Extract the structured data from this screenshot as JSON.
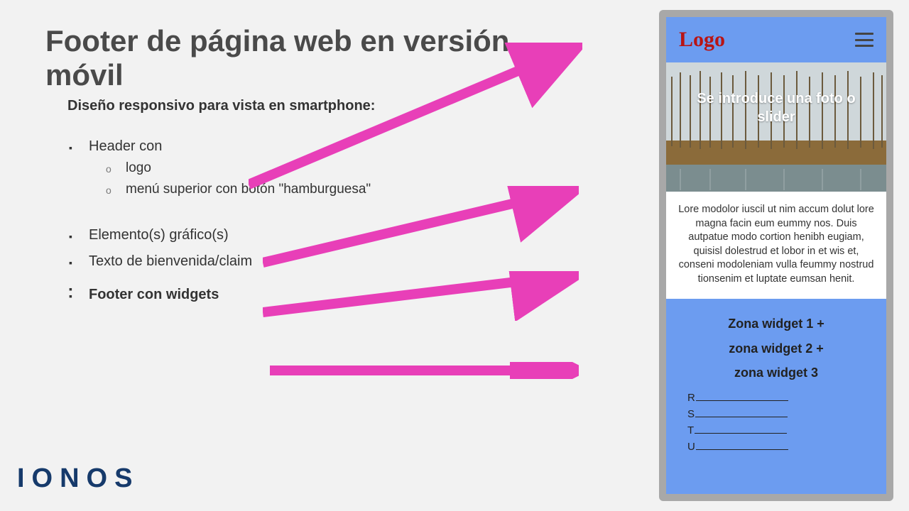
{
  "title": "Footer de página web en versión móvil",
  "subheading": "Diseño responsivo para vista en smartphone:",
  "bullets": {
    "b1": "Header con",
    "b1a": "logo",
    "b1b": "menú superior con botón \"hamburguesa\"",
    "b2": "Elemento(s) gráfico(s)",
    "b3": "Texto de bienvenida/claim",
    "b4": "Footer con widgets"
  },
  "brand": "IONOS",
  "phone": {
    "logo": "Logo",
    "hero_caption": "Se introduce una foto o slider",
    "welcome": "Lore modolor iuscil ut nim accum dolut lore magna facin eum eummy nos. Duis autpatue modo cortion henibh eugiam, quisisl dolestrud et lobor in et wis et, conseni modoleniam vulla feummy nostrud tionsenim et luptate eumsan henit.",
    "widget1": "Zona widget 1 +",
    "widget2": "zona widget 2 +",
    "widget3": "zona widget 3",
    "link_r": "R",
    "link_s": "S",
    "link_t": "T",
    "link_u": "U"
  },
  "colors": {
    "accent_arrow": "#e83fb8",
    "phone_blue": "#6c9cf0",
    "logo_red": "#b81414",
    "brand_blue": "#163a6b"
  }
}
